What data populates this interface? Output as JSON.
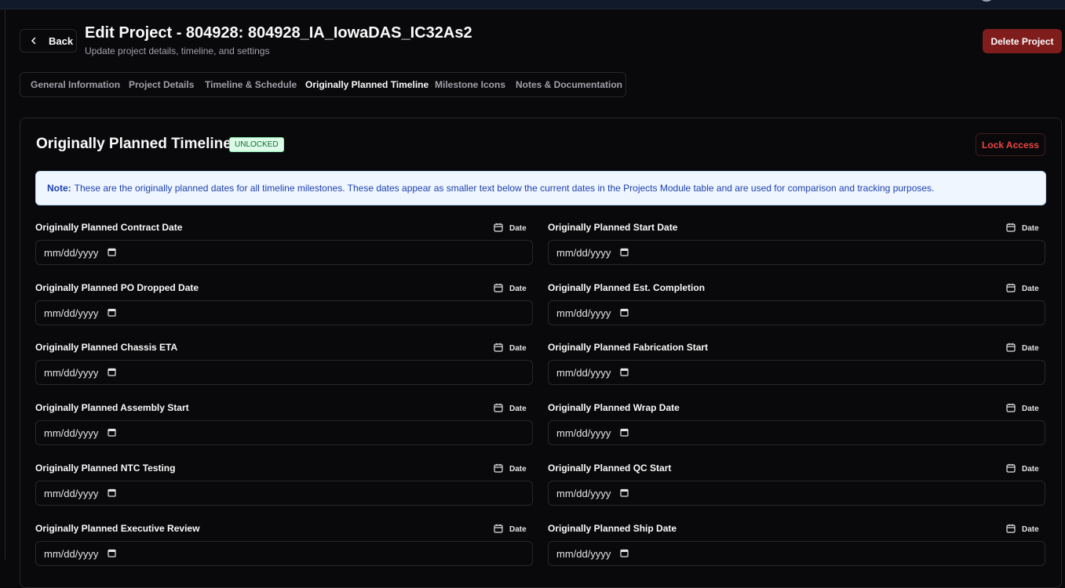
{
  "header": {
    "back_label": "Back",
    "title": "Edit Project - 804928: 804928_IA_IowaDAS_IC32As2",
    "subtitle": "Update project details, timeline, and settings",
    "delete_label": "Delete Project"
  },
  "tabs": [
    {
      "label": "General Information",
      "active": false
    },
    {
      "label": "Project Details",
      "active": false
    },
    {
      "label": "Timeline & Schedule",
      "active": false
    },
    {
      "label": "Originally Planned Timeline",
      "active": true
    },
    {
      "label": "Milestone Icons",
      "active": false
    },
    {
      "label": "Notes & Documentation",
      "active": false
    }
  ],
  "section": {
    "title": "Originally Planned Timeline",
    "status_badge": "UNLOCKED",
    "lock_label": "Lock Access",
    "note_prefix": "Note:",
    "note_text": "These are the originally planned dates for all timeline milestones. These dates appear as smaller text below the current dates in the Projects Module table and are used for comparison and tracking purposes."
  },
  "date_tag_label": "Date",
  "fields": [
    {
      "label": "Originally Planned Contract Date",
      "value": "mm/dd/yyyy"
    },
    {
      "label": "Originally Planned Start Date",
      "value": "mm/dd/yyyy"
    },
    {
      "label": "Originally Planned PO Dropped Date",
      "value": "mm/dd/yyyy"
    },
    {
      "label": "Originally Planned Est. Completion",
      "value": "mm/dd/yyyy"
    },
    {
      "label": "Originally Planned Chassis ETA",
      "value": "mm/dd/yyyy"
    },
    {
      "label": "Originally Planned Fabrication Start",
      "value": "mm/dd/yyyy"
    },
    {
      "label": "Originally Planned Assembly Start",
      "value": "mm/dd/yyyy"
    },
    {
      "label": "Originally Planned Wrap Date",
      "value": "mm/dd/yyyy"
    },
    {
      "label": "Originally Planned NTC Testing",
      "value": "mm/dd/yyyy"
    },
    {
      "label": "Originally Planned QC Start",
      "value": "mm/dd/yyyy"
    },
    {
      "label": "Originally Planned Executive Review",
      "value": "mm/dd/yyyy"
    },
    {
      "label": "Originally Planned Ship Date",
      "value": "mm/dd/yyyy"
    }
  ],
  "colors": {
    "background": "#09090b",
    "delete": "#7f1d1d",
    "lock_text": "#ef4444",
    "badge_bg": "#dcfce7",
    "note_bg": "#eff6ff",
    "note_text": "#1e40af"
  }
}
